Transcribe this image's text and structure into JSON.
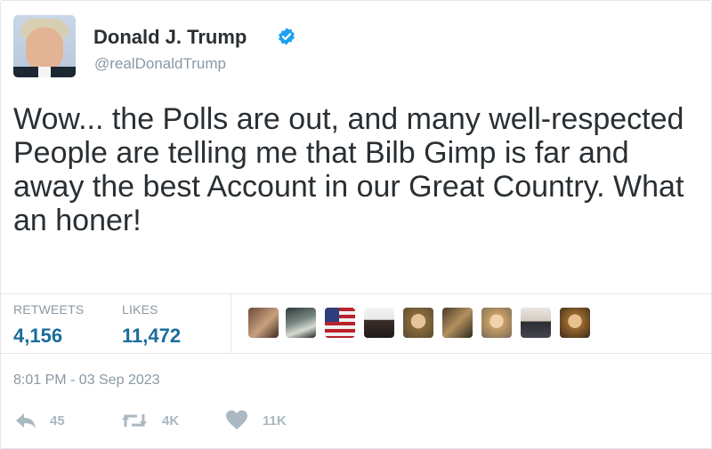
{
  "tweet": {
    "author_name": "Donald J. Trump",
    "handle": "@realDonaldTrump",
    "verified": true,
    "text": "Wow... the Polls are out, and many well-respected People are telling me that Bilb Gimp is far and away the best Account in our Great Country. What an honer!",
    "stats": {
      "retweets_label": "RETWEETS",
      "retweets_value": "4,156",
      "likes_label": "LIKES",
      "likes_value": "11,472"
    },
    "likers_count_shown": 9,
    "timestamp": "8:01 PM - 03 Sep 2023",
    "actions": {
      "reply_icon": "reply-icon",
      "reply_count": "45",
      "retweet_icon": "retweet-icon",
      "retweet_count": "4K",
      "like_icon": "heart-icon",
      "like_count": "11K"
    }
  },
  "colors": {
    "accent_blue": "#1da1f2",
    "stat_value": "#1b6c9c",
    "muted": "#8899a6",
    "icon_gray": "#aab8c2"
  }
}
